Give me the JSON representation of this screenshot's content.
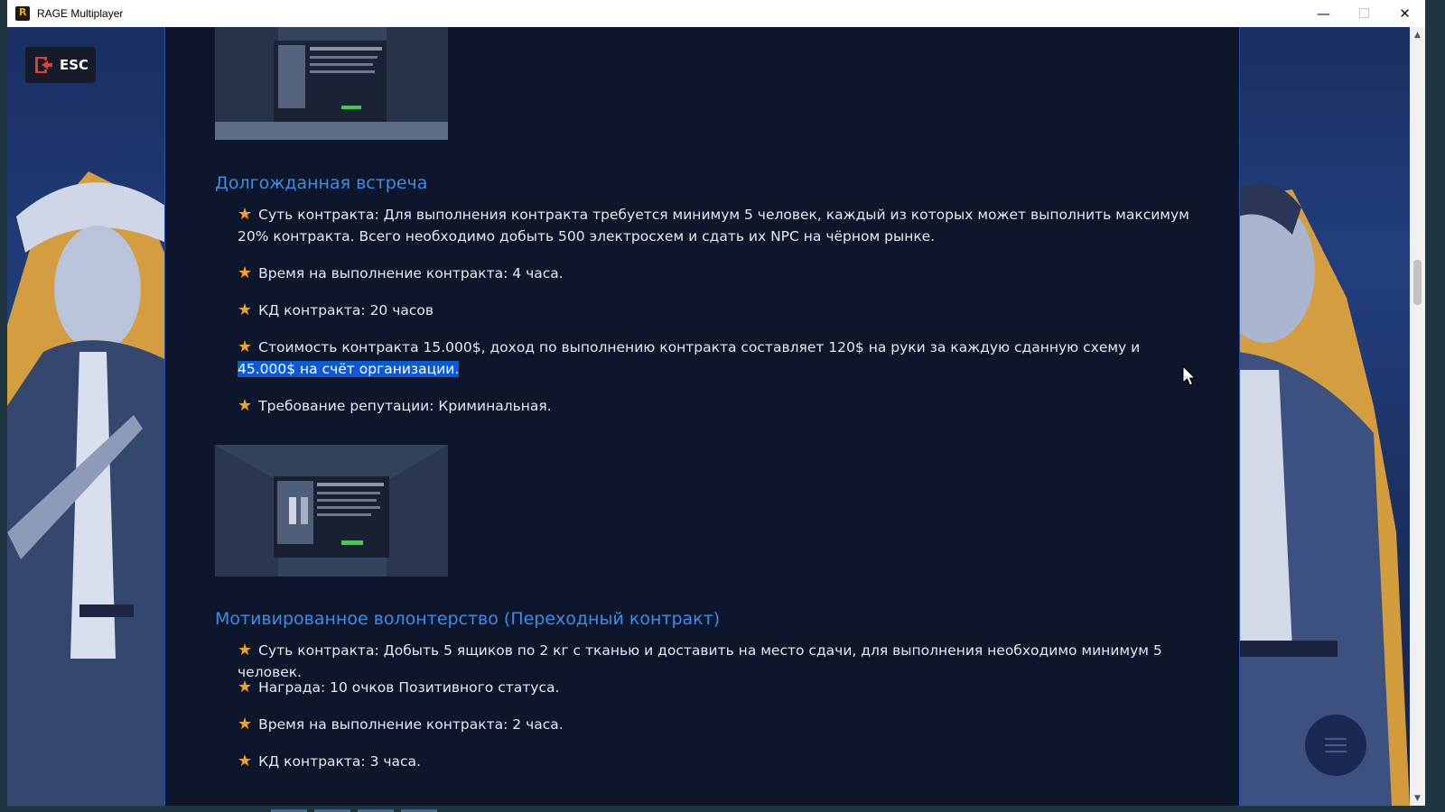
{
  "window": {
    "title": "RAGE Multiplayer",
    "controls": {
      "minimize": "—",
      "maximize": "☐",
      "close": "✕"
    }
  },
  "esc_button": {
    "label": "ESC"
  },
  "sections": [
    {
      "title": "Долгожданная встреча",
      "items": [
        {
          "text": "Суть контракта: Для выполнения контракта требуется минимум 5 человек, каждый из которых может выполнить максимум 20% контракта. Всего необходимо добыть 500 электросхем и сдать их NPC на чёрном рынке."
        },
        {
          "text": "Время на выполнение контракта: 4 часа."
        },
        {
          "text": "КД контракта: 20 часов"
        },
        {
          "text": "Стоимость контракта 15.000$, доход по выполнению контракта составляет 120$ на руки за каждую сданную схему и ",
          "highlight": "45.000$ на счёт организации."
        },
        {
          "text": "Требование репутации: Криминальная."
        }
      ]
    },
    {
      "title": "Мотивированное волонтерство (Переходный контракт)",
      "items": [
        {
          "text": "Суть контракта: Добыть 5 ящиков по 2 кг с тканью и доставить на место сдачи, для выполнения необходимо минимум 5 человек."
        },
        {
          "text": "Награда: 10 очков Позитивного статуса."
        },
        {
          "text": "Время на выполнение контракта: 2 часа."
        },
        {
          "text": "КД контракта: 3 часа."
        }
      ]
    }
  ],
  "colors": {
    "accent": "#3a8ee8",
    "star": "#f4a31e",
    "selection": "#0a5bd3",
    "panel": "#0e162b"
  }
}
